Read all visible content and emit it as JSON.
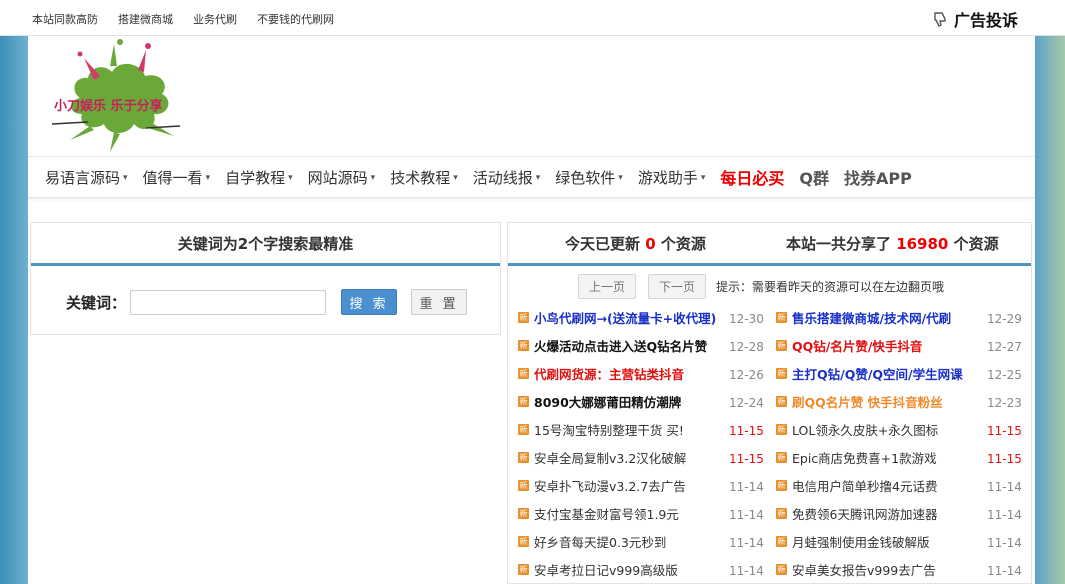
{
  "topbar": {
    "links": [
      "本站同款高防",
      "搭建微商城",
      "业务代刷",
      "不要钱的代刷网"
    ],
    "ad_report": "广告投诉",
    "ad_icon": "thumbs-down-icon"
  },
  "logo": {
    "text": "小刀娱乐 乐于分享"
  },
  "nav": {
    "items": [
      {
        "label": "易语言源码",
        "dropdown": true
      },
      {
        "label": "值得一看",
        "dropdown": true
      },
      {
        "label": "自学教程",
        "dropdown": true
      },
      {
        "label": "网站源码",
        "dropdown": true
      },
      {
        "label": "技术教程",
        "dropdown": true
      },
      {
        "label": "活动线报",
        "dropdown": true
      },
      {
        "label": "绿色软件",
        "dropdown": true
      },
      {
        "label": "游戏助手",
        "dropdown": true
      },
      {
        "label": "每日必买",
        "dropdown": false
      },
      {
        "label": "Q群",
        "dropdown": false
      },
      {
        "label": "找券APP",
        "dropdown": false
      }
    ]
  },
  "search": {
    "title": "关键词为2个字搜索最精准",
    "label": "关键词：",
    "placeholder": "",
    "search_button": "搜 索",
    "reset_button": "重 置"
  },
  "stats": {
    "today_prefix": "今天已更新",
    "today_count": "0",
    "today_suffix": "个资源",
    "total_prefix": "本站一共分享了",
    "total_count": "16980",
    "total_suffix": "个资源"
  },
  "pager": {
    "prev": "上一页",
    "next": "下一页",
    "tip": "提示：需要看昨天的资源可以在左边翻页哦"
  },
  "new_badge": "新",
  "rows": [
    [
      {
        "title": "小鸟代刷网→(送流量卡+收代理)",
        "date": "12-30",
        "style": "blue"
      },
      {
        "title": "售乐搭建微商城/技术网/代刷",
        "date": "12-29",
        "style": "blue"
      }
    ],
    [
      {
        "title": "火爆活动点击进入送Q钻名片赞",
        "date": "12-28",
        "style": "bold"
      },
      {
        "title": "QQ钻/名片赞/快手抖音",
        "date": "12-27",
        "style": "red"
      }
    ],
    [
      {
        "title": "代刷网货源：主营钻类抖音",
        "date": "12-26",
        "style": "red"
      },
      {
        "title": "主打Q钻/Q赞/Q空间/学生网课",
        "date": "12-25",
        "style": "blue"
      }
    ],
    [
      {
        "title": "8090大娜娜莆田精仿潮牌",
        "date": "12-24",
        "style": "bold"
      },
      {
        "title": "刷QQ名片赞 快手抖音粉丝",
        "date": "12-23",
        "style": "orange"
      }
    ],
    [
      {
        "title": "15号淘宝特别整理干货 买!",
        "date": "11-15",
        "style": "normal",
        "date_red": true
      },
      {
        "title": "LOL领永久皮肤+永久图标",
        "date": "11-15",
        "style": "normal",
        "date_red": true
      }
    ],
    [
      {
        "title": "安卓全局复制v3.2汉化破解",
        "date": "11-15",
        "style": "normal",
        "date_red": true
      },
      {
        "title": "Epic商店免费喜+1款游戏",
        "date": "11-15",
        "style": "normal",
        "date_red": true
      }
    ],
    [
      {
        "title": "安卓扑飞动漫v3.2.7去广告",
        "date": "11-14",
        "style": "normal"
      },
      {
        "title": "电信用户简单秒撸4元话费",
        "date": "11-14",
        "style": "normal"
      }
    ],
    [
      {
        "title": "支付宝基金财富号领1.9元",
        "date": "11-14",
        "style": "normal"
      },
      {
        "title": "免费领6天腾讯网游加速器",
        "date": "11-14",
        "style": "normal"
      }
    ],
    [
      {
        "title": "好乡音每天提0.3元秒到",
        "date": "11-14",
        "style": "normal"
      },
      {
        "title": "月蛙强制使用金钱破解版",
        "date": "11-14",
        "style": "normal"
      }
    ],
    [
      {
        "title": "安卓考拉日记v999高级版",
        "date": "11-14",
        "style": "normal"
      },
      {
        "title": "安卓美女报告v999去广告",
        "date": "11-14",
        "style": "normal"
      }
    ]
  ]
}
